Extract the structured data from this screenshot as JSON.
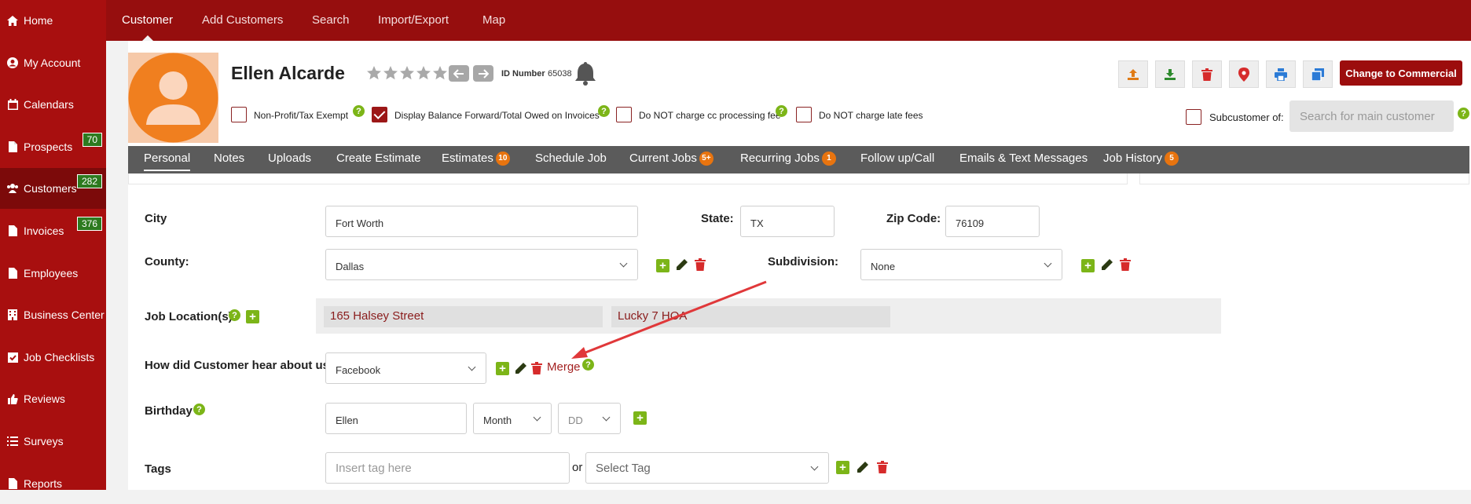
{
  "sidebar": {
    "items": [
      {
        "label": "Home",
        "icon": "home-icon"
      },
      {
        "label": "My Account",
        "icon": "user-circle-icon"
      },
      {
        "label": "Calendars",
        "icon": "calendar-icon"
      },
      {
        "label": "Prospects",
        "icon": "document-icon",
        "badge": "70"
      },
      {
        "label": "Customers",
        "icon": "users-icon",
        "badge": "282"
      },
      {
        "label": "Invoices",
        "icon": "document-icon",
        "badge": "376"
      },
      {
        "label": "Employees",
        "icon": "document-icon"
      },
      {
        "label": "Business Center",
        "icon": "building-icon"
      },
      {
        "label": "Job Checklists",
        "icon": "checkbox-icon"
      },
      {
        "label": "Reviews",
        "icon": "thumbs-up-icon"
      },
      {
        "label": "Surveys",
        "icon": "list-icon"
      },
      {
        "label": "Reports",
        "icon": "document-icon"
      }
    ]
  },
  "topnav": {
    "tabs": [
      "Customer",
      "Add Customers",
      "Search",
      "Import/Export",
      "Map"
    ]
  },
  "customer": {
    "name": "Ellen Alcarde",
    "id_label": "ID Number",
    "id_value": "65038",
    "rating": 0
  },
  "toolbar": {
    "icons": [
      "upload-icon",
      "download-icon",
      "trash-icon",
      "map-pin-icon",
      "print-icon",
      "copy-icon"
    ],
    "change_label": "Change to Commercial"
  },
  "options": {
    "nonprofit": {
      "label": "Non-Profit/Tax Exempt",
      "checked": false
    },
    "balance": {
      "label": "Display Balance Forward/Total Owed on Invoices",
      "checked": true
    },
    "cc_fee": {
      "label": "Do NOT charge cc processing fee",
      "checked": false
    },
    "late_fee": {
      "label": "Do NOT charge late fees",
      "checked": false
    },
    "subcustomer": {
      "label": "Subcustomer of:",
      "placeholder": "Search for main customer"
    }
  },
  "tabs": [
    {
      "label": "Personal"
    },
    {
      "label": "Notes"
    },
    {
      "label": "Uploads"
    },
    {
      "label": "Create Estimate"
    },
    {
      "label": "Estimates",
      "badge": "10"
    },
    {
      "label": "Schedule Job"
    },
    {
      "label": "Current Jobs",
      "badge": "5+"
    },
    {
      "label": "Recurring Jobs",
      "badge": "1"
    },
    {
      "label": "Follow up/Call"
    },
    {
      "label": "Emails & Text Messages"
    },
    {
      "label": "Job History",
      "badge": "5"
    }
  ],
  "form": {
    "city": {
      "label": "City",
      "value": "Fort Worth"
    },
    "state": {
      "label": "State:",
      "value": "TX"
    },
    "zip": {
      "label": "Zip Code:",
      "value": "76109"
    },
    "county": {
      "label": "County:",
      "value": "Dallas"
    },
    "subdivision": {
      "label": "Subdivision:",
      "value": "None"
    },
    "job_location": {
      "label": "Job Location(s)",
      "address": "165 Halsey Street",
      "name": "Lucky 7 HOA"
    },
    "hear": {
      "label": "How did Customer hear about us?",
      "value": "Facebook",
      "merge": "Merge"
    },
    "birthday": {
      "label": "Birthday",
      "name": "Ellen",
      "month": "Month",
      "day": "DD"
    },
    "tags": {
      "label": "Tags",
      "placeholder": "Insert tag here",
      "or": "or",
      "select": "Select Tag"
    }
  },
  "colors": {
    "brand": "#a80f0f",
    "accent_green": "#7cb518",
    "badge_orange": "#e8740f",
    "annotation": "#e0383a"
  }
}
